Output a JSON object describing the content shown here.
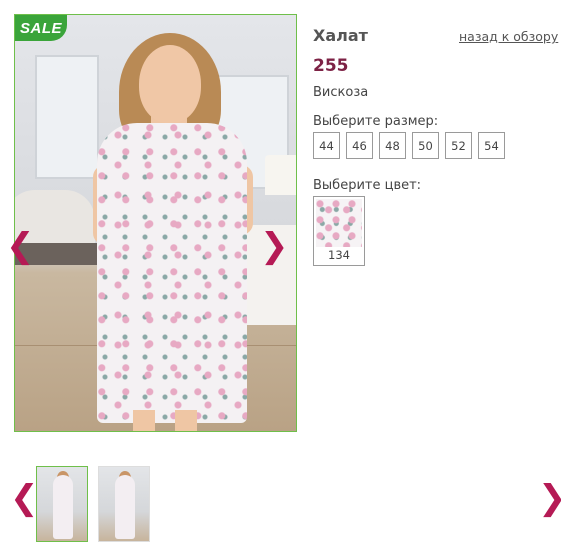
{
  "product": {
    "title": "Халат",
    "price": "255",
    "material": "Вискоза",
    "back_link": "назад к обзору"
  },
  "badge": {
    "sale": "SALE"
  },
  "sizes": {
    "label": "Выберите размер:",
    "options": [
      "44",
      "46",
      "48",
      "50",
      "52",
      "54"
    ]
  },
  "colors": {
    "label": "Выберите цвет:",
    "options": [
      {
        "code": "134"
      }
    ]
  },
  "gallery": {
    "prev_glyph": "❮",
    "next_glyph": "❯",
    "thumbnails": [
      "model-front",
      "model-back"
    ]
  },
  "palette": {
    "accent": "#b51a55",
    "price": "#7d2245",
    "active_border": "#6fbf4a",
    "sale_badge": "#3aa43a"
  }
}
